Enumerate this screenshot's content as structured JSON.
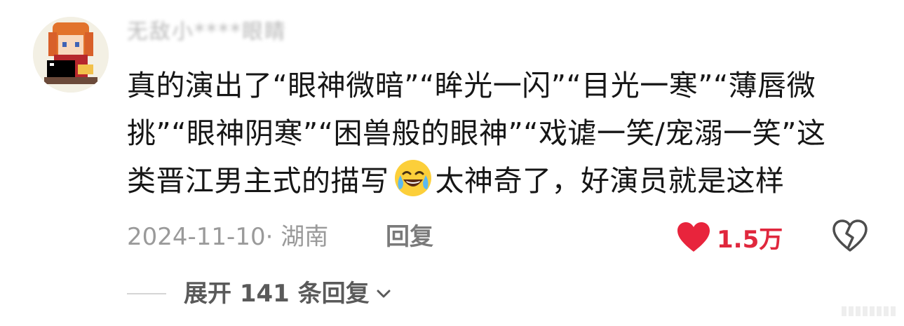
{
  "comment": {
    "username": "无敌小****眼睛",
    "avatar_icon": "pixel-character-avatar-icon",
    "text_lines": [
      "真的演出了“眼神微暗”“眸光一闪”“目光一寒”“薄唇微",
      "挑”“眼神阴寒”“困兽般的眼神”“戏谑一笑/宠溺一笑”这",
      "类晋江男主式的描写"
    ],
    "text_after_emoji": "太神奇了，好演员就是这样",
    "emoji_icon": "crying-laughing-face-icon",
    "date_location": "2024-11-10· 湖南",
    "reply_label": "回复",
    "like_icon": "heart-icon",
    "like_count": "1.5万",
    "like_color": "#e8243c",
    "dislike_icon": "broken-heart-icon",
    "expand_label": "展开 141 条回复",
    "expand_icon": "chevron-down-icon"
  }
}
